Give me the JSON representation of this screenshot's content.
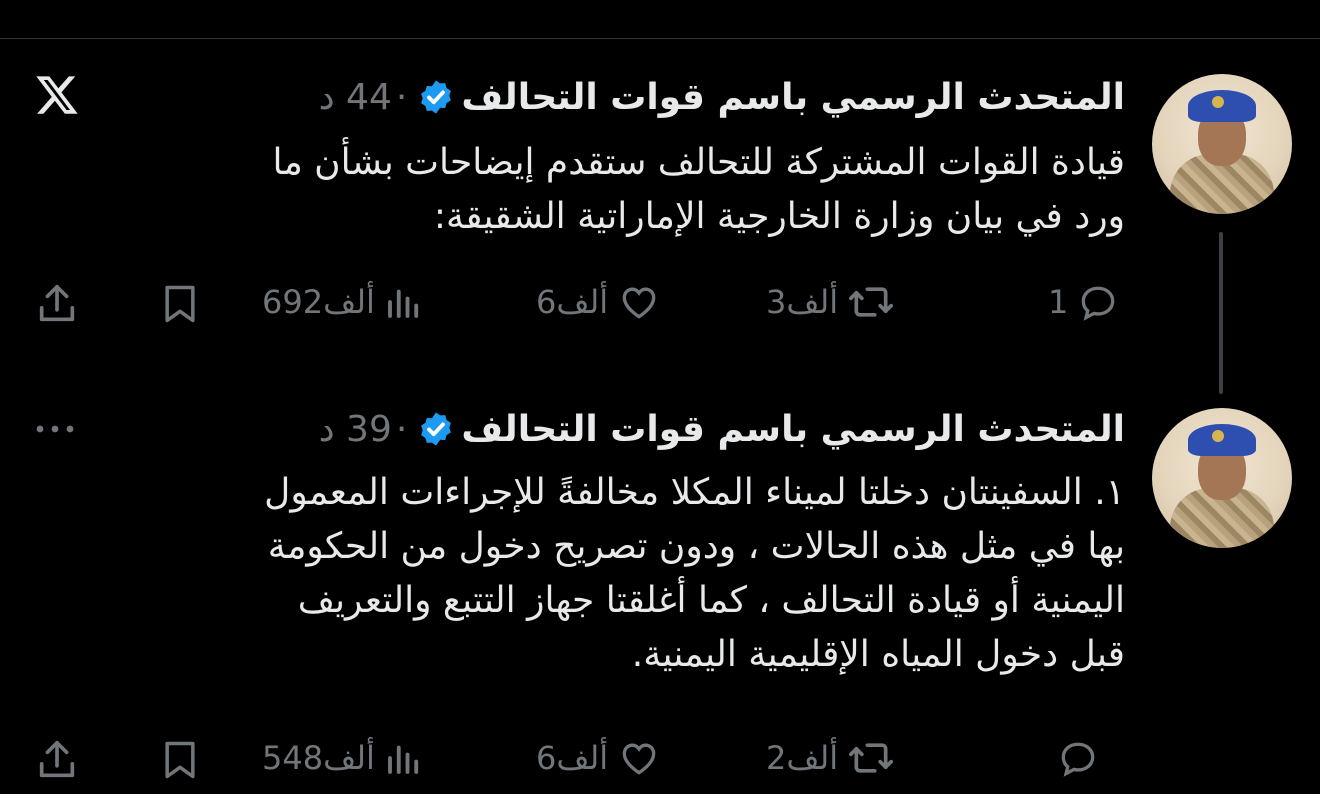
{
  "colors": {
    "background": "#000000",
    "text": "#e7e9ea",
    "muted": "#71767b",
    "verified": "#1d9bf0"
  },
  "tweets": [
    {
      "author": "المتحدث الرسمي باسم قوات التحالف",
      "separator": "·",
      "time": "44 د",
      "lines": [
        "قيادة القوات المشتركة للتحالف ستقدم إيضاحات بشأن ما",
        "ورد في بيان وزارة الخارجية الإماراتية الشقيقة:"
      ],
      "replies": "1",
      "retweets": "3ألف",
      "likes": "6ألف",
      "views": "692ألف",
      "icons": [
        "reply-icon",
        "retweet-icon",
        "like-icon",
        "views-icon",
        "bookmark-icon",
        "share-icon"
      ]
    },
    {
      "author": "المتحدث الرسمي باسم قوات التحالف",
      "separator": "·",
      "time": "39 د",
      "lines": [
        "١. السفينتان دخلتا لميناء المكلا مخالفةً للإجراءات المعمول",
        "بها في مثل هذه الحالات ، ودون تصريح دخول من الحكومة",
        "اليمنية أو قيادة التحالف ، كما أغلقتا جهاز التتبع والتعريف",
        "قبل دخول المياه الإقليمية اليمنية."
      ],
      "replies": "",
      "retweets": "2ألف",
      "likes": "6ألف",
      "views": "548ألف",
      "icons": [
        "reply-icon",
        "retweet-icon",
        "like-icon",
        "views-icon",
        "bookmark-icon",
        "share-icon"
      ]
    }
  ],
  "header_icons": [
    "x-logo-icon",
    "more-icon"
  ]
}
